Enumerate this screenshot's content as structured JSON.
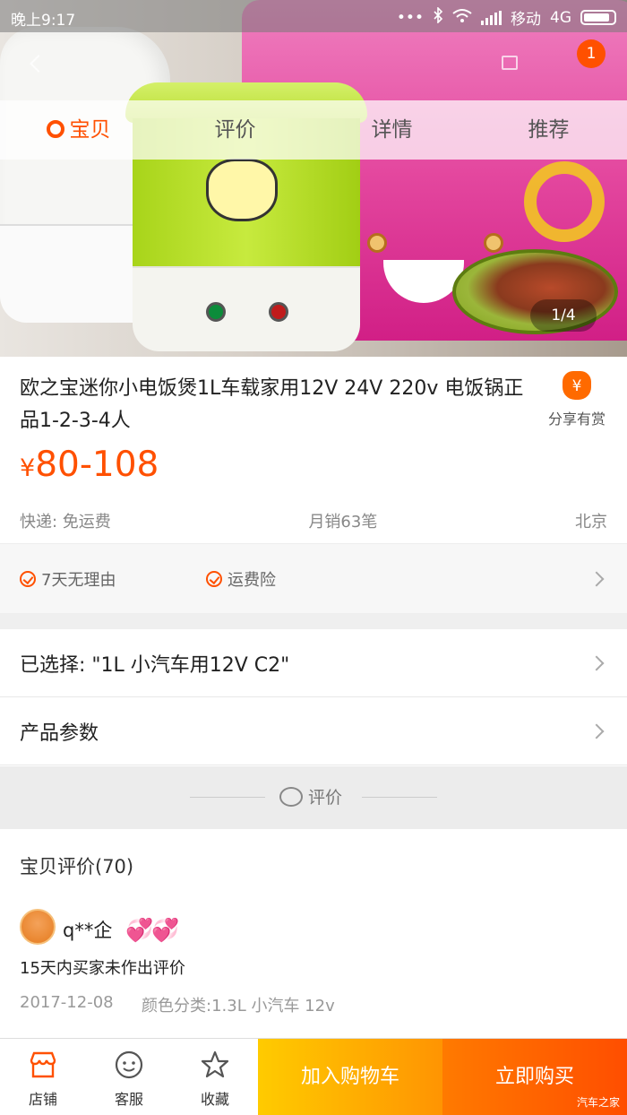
{
  "status_bar": {
    "time": "晚上9:17",
    "carrier": "移动",
    "network": "4G",
    "dots": "•••"
  },
  "header": {
    "cart_badge": "1"
  },
  "tabs": [
    {
      "label": "宝贝",
      "active": true
    },
    {
      "label": "评价",
      "active": false
    },
    {
      "label": "详情",
      "active": false
    },
    {
      "label": "推荐",
      "active": false
    }
  ],
  "gallery": {
    "counter": "1/4"
  },
  "product": {
    "title": "欧之宝迷你小电饭煲1L车载家用12V 24V 220v 电饭锅正品1-2-3-4人",
    "currency": "¥",
    "price": "80-108",
    "shipping": "快递: 免运费",
    "monthly_sales": "月销63笔",
    "location": "北京",
    "share_label": "分享有赏",
    "share_icon_char": "¥"
  },
  "services": [
    "7天无理由",
    "运费险"
  ],
  "selection": {
    "label": "已选择: \"1L 小汽车用12V C2\""
  },
  "params": {
    "label": "产品参数"
  },
  "reviews_section": {
    "divider_label": "评价",
    "header": "宝贝评价(70)",
    "review": {
      "username": "q**企",
      "hearts": "💞💞",
      "text": "15天内买家未作出评价",
      "date": "2017-12-08",
      "sku": "颜色分类:1.3L 小汽车 12v"
    }
  },
  "bottom_bar": {
    "shop": "店铺",
    "service": "客服",
    "favorite": "收藏",
    "add_to_cart": "加入购物车",
    "buy_now": "立即购买",
    "watermark": "汽车之家"
  },
  "colors": {
    "accent": "#ff5000",
    "cart_button": "#ffa200",
    "buy_button": "#ff5a00"
  },
  "icons": [
    "store-icon",
    "customer-service-icon",
    "star-icon",
    "share-bag-icon",
    "check-circle-icon",
    "chevron-right-icon",
    "comment-bubble-icon",
    "back-icon",
    "cart-icon"
  ]
}
